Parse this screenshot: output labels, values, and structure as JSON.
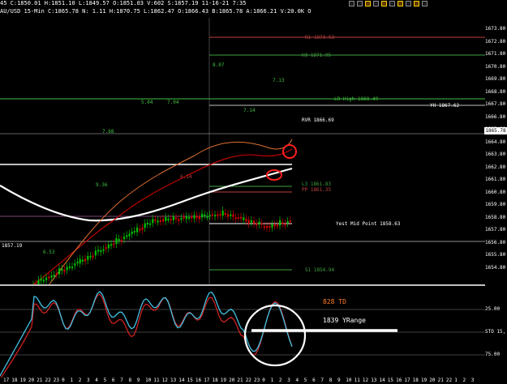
{
  "header": {
    "line1": "45 C:1850.01 H:1851.10 L:1849.57 O:1851.03 V:602 S:1857.19 11-16-21 7:35",
    "line2": "AU/USD 15-Min C:1865.78 N: 1.11 H:1870.75 L:1862.47 O:1866.43 B:1865.78 A:1866.21 V:20.0K O"
  },
  "price_axis": [
    "1673.80",
    "1672.80",
    "1671.80",
    "1670.80",
    "1669.80",
    "1668.80",
    "1667.80",
    "1666.80",
    "1665.80",
    "1664.80",
    "1663.80",
    "1662.80",
    "1661.80",
    "1660.80",
    "1659.80",
    "1658.80",
    "1657.80",
    "1656.80",
    "1655.80",
    "1654.80"
  ],
  "current_price": "1865.78",
  "levels": {
    "r1": "R1 1873.53",
    "h3": "H3 1871.95",
    "lr_high": "LR High 1868.49",
    "yh": "YH 1867.62",
    "rvr": "RVR 1866.69",
    "l3": "L3 1861.83",
    "pp": "PP 1861.35",
    "yest_mid": "Yest Mid Point 1858.63",
    "s1": "S1 1854.94"
  },
  "chart_annotations": [
    "8.07",
    "7.13",
    "5.04",
    "7.04",
    "7.14",
    "7.68",
    "9.36",
    "6.53",
    "6.14",
    "1857.19"
  ],
  "indicator": {
    "td_label": "828 TD",
    "range_label": "1839 YRange",
    "axis": [
      "25.00",
      "STO 15,",
      "75.00"
    ]
  },
  "time_axis": [
    "17",
    "18",
    "19",
    "20",
    "21",
    "22",
    "23",
    "0",
    "1",
    "2",
    "3",
    "4",
    "5",
    "6",
    "7",
    "8",
    "9",
    "10",
    "11",
    "12",
    "13",
    "14",
    "15",
    "16",
    "17",
    "18",
    "19",
    "20",
    "21",
    "22",
    "23",
    "0",
    "1",
    "2",
    "3",
    "4",
    "5",
    "6",
    "7",
    "8",
    "9",
    "10",
    "11",
    "12",
    "13",
    "14",
    "15",
    "16",
    "17",
    "18",
    "19",
    "20",
    "21",
    "22",
    "1",
    "2",
    "3"
  ],
  "colors": {
    "up_candle": "#00c000",
    "down_candle": "#d00000",
    "ma_white": "#ffffff",
    "ma_red": "#c00000",
    "ma_orange": "#e07030",
    "stoch_k": "#40c0e0",
    "stoch_d": "#d02020",
    "pivot_green": "#40a040",
    "pivot_red": "#c04040",
    "highlight": "#ff2020",
    "td_orange": "#ff7f27"
  },
  "toolbar_icons": [
    "minimize-icon",
    "maximize-icon",
    "close-icon",
    "grid-icon",
    "zoom-icon",
    "cursor-icon",
    "draw-icon",
    "text-icon",
    "settings-icon",
    "window-icon"
  ]
}
